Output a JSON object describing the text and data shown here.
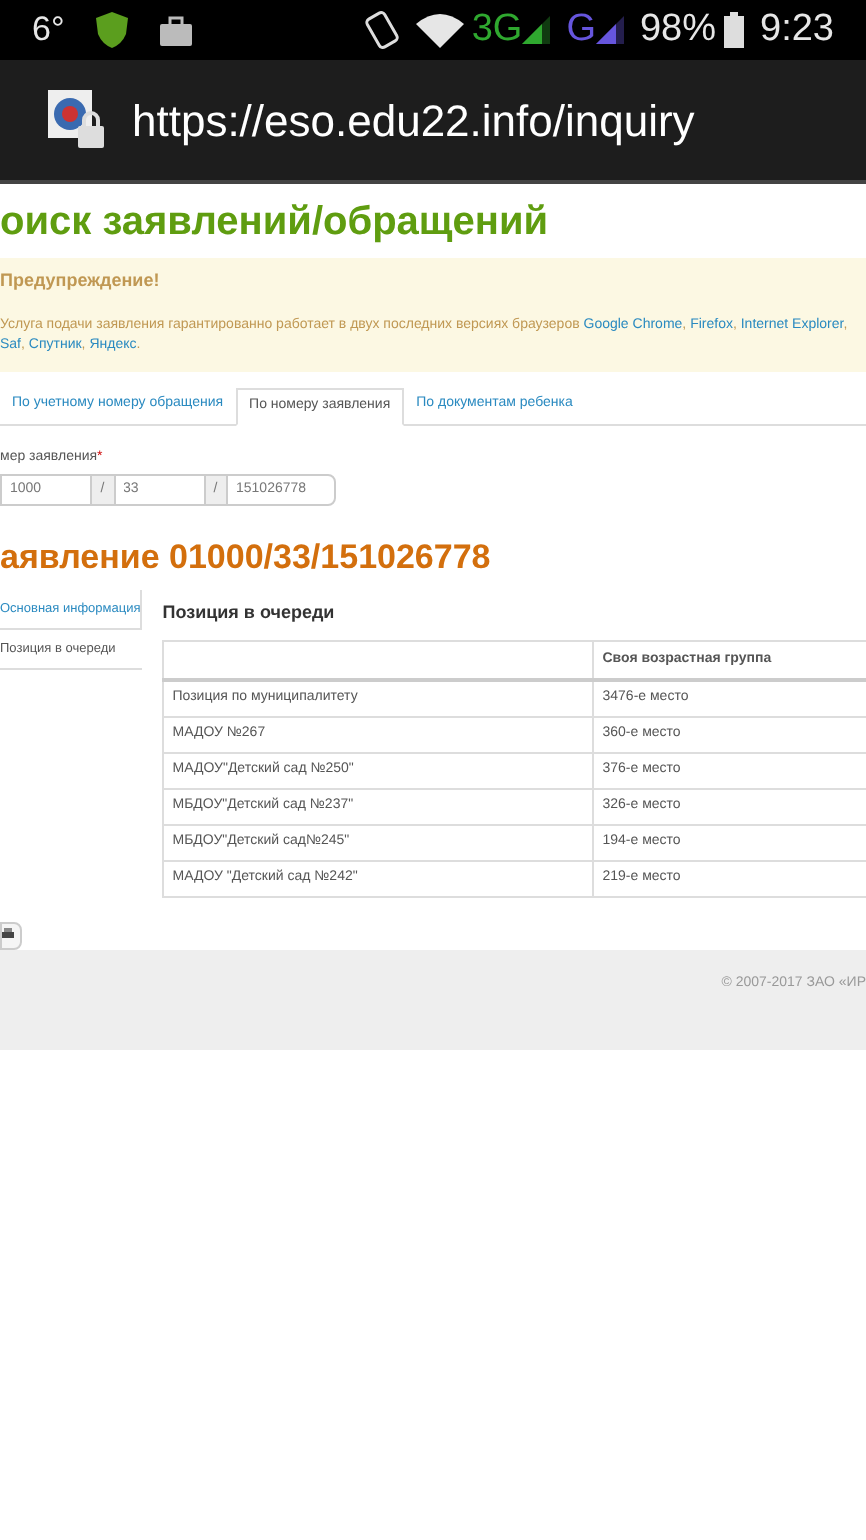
{
  "status_bar": {
    "temperature": "6°",
    "network_3g": "3G",
    "network_g": "G",
    "battery": "98%",
    "time": "9:23"
  },
  "browser": {
    "url": "https://eso.edu22.info/inquiry"
  },
  "page_title": "оиск заявлений/обращений",
  "warning": {
    "title": "Предупреждение!",
    "text_before": "Услуга подачи заявления гарантированно работает в двух последних версиях браузеров ",
    "links": [
      "Google Chrome",
      "Firefox",
      "Internet Explorer",
      "Saf",
      "Спутник",
      "Яндекс"
    ],
    "link_separator": ",",
    "text_after": "."
  },
  "search_tabs": [
    {
      "label": "По учетному номеру обращения",
      "selected": false
    },
    {
      "label": "По номеру заявления",
      "selected": true
    },
    {
      "label": "По документам ребенка",
      "selected": false
    }
  ],
  "number_field": {
    "label": "мер заявления",
    "required_mark": "*",
    "parts": [
      "1000",
      "33",
      "151026778"
    ],
    "separator": "/"
  },
  "application_title": "аявление 01000/33/151026778",
  "side_nav": [
    {
      "label": "Основная информация",
      "selected": false
    },
    {
      "label": "Позиция в очереди",
      "selected": true
    }
  ],
  "queue": {
    "title": "Позиция в очереди",
    "columns": [
      "",
      "Своя возрастная группа"
    ],
    "rows": [
      [
        "Позиция по муниципалитету",
        "3476-е место"
      ],
      [
        "МАДОУ №267",
        "360-е место"
      ],
      [
        "МАДОУ\"Детский сад №250\"",
        "376-е место"
      ],
      [
        "МБДОУ\"Детский сад №237\"",
        "326-е место"
      ],
      [
        "МБДОУ\"Детский сад№245\"",
        "194-е место"
      ],
      [
        "МАДОУ \"Детский сад №242\"",
        "219-е место"
      ]
    ]
  },
  "footer": {
    "copyright": "© 2007-2017 ЗАО «ИР"
  }
}
